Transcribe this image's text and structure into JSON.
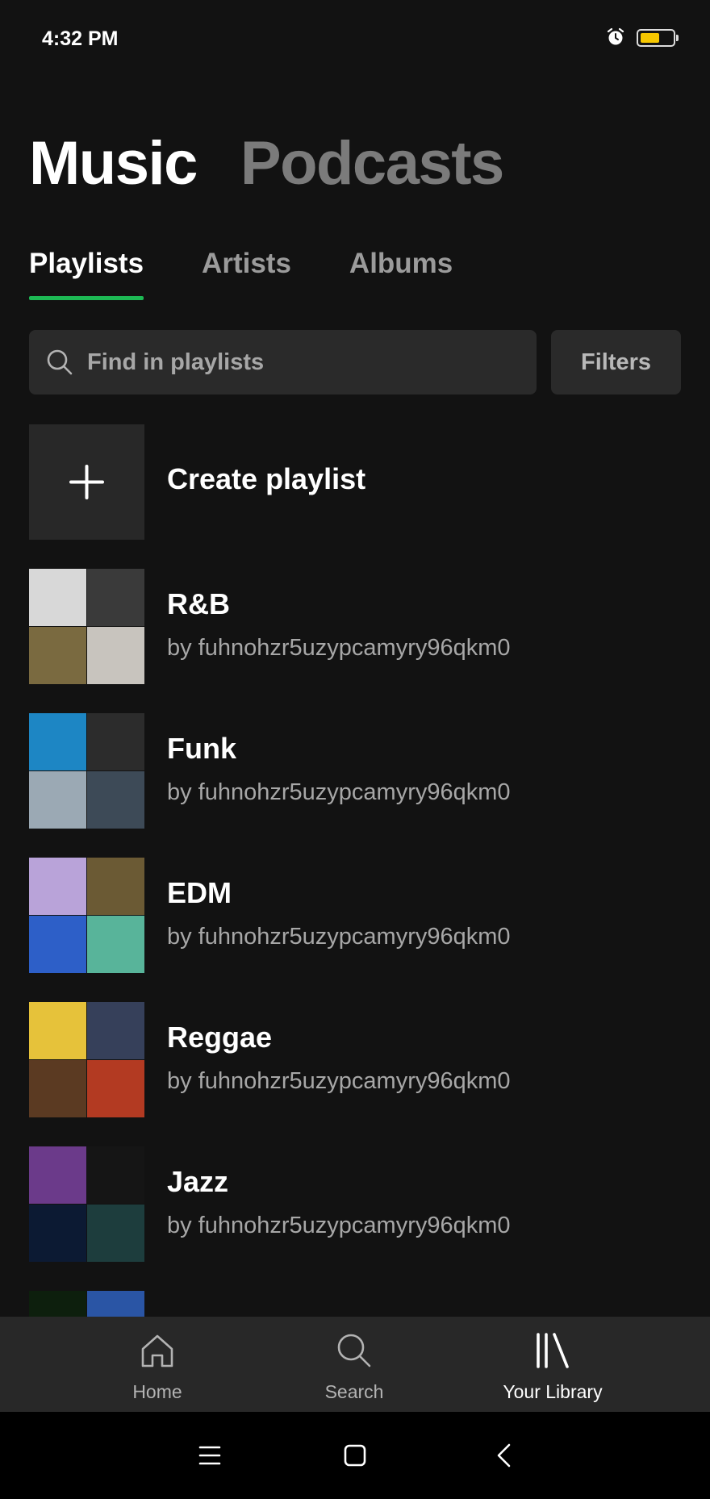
{
  "status_bar": {
    "time": "4:32 PM",
    "battery_level": 0.6,
    "icons": [
      "alarm-icon",
      "battery-icon"
    ]
  },
  "header": {
    "tabs": [
      "Music",
      "Podcasts"
    ],
    "active": "Music"
  },
  "sub_tabs": {
    "tabs": [
      "Playlists",
      "Artists",
      "Albums"
    ],
    "active": "Playlists"
  },
  "search": {
    "placeholder": "Find in playlists",
    "filters_label": "Filters"
  },
  "create_playlist": {
    "label": "Create playlist"
  },
  "playlists": [
    {
      "title": "R&B",
      "subtitle": "by fuhnohzr5uzypcamyry96qkm0",
      "cover_colors": [
        "#d8d8d8",
        "#3a3a3a",
        "#7a6a40",
        "#c8c4be"
      ]
    },
    {
      "title": "Funk",
      "subtitle": "by fuhnohzr5uzypcamyry96qkm0",
      "cover_colors": [
        "#1d86c4",
        "#2c2c2c",
        "#9ba9b4",
        "#3d4a57"
      ]
    },
    {
      "title": "EDM",
      "subtitle": "by fuhnohzr5uzypcamyry96qkm0",
      "cover_colors": [
        "#b9a3d9",
        "#6b5a34",
        "#2d5fc8",
        "#58b49a"
      ]
    },
    {
      "title": "Reggae",
      "subtitle": "by fuhnohzr5uzypcamyry96qkm0",
      "cover_colors": [
        "#e6c23a",
        "#36405a",
        "#5b3a22",
        "#b33a22"
      ]
    },
    {
      "title": "Jazz",
      "subtitle": "by fuhnohzr5uzypcamyry96qkm0",
      "cover_colors": [
        "#6b3a8a",
        "#151515",
        "#0c1a33",
        "#1d3d3d"
      ]
    },
    {
      "title": "",
      "subtitle": "",
      "cover_colors": [
        "#0d1f0d",
        "#2a55a5",
        "#101010",
        "#101010"
      ]
    }
  ],
  "bottom_nav": {
    "items": [
      {
        "label": "Home",
        "icon": "home-icon"
      },
      {
        "label": "Search",
        "icon": "search-icon"
      },
      {
        "label": "Your Library",
        "icon": "library-icon"
      }
    ],
    "active": "Your Library"
  },
  "system_nav": {
    "icons": [
      "menu-icon",
      "home-square-icon",
      "back-icon"
    ]
  },
  "colors": {
    "background": "#121212",
    "accent": "#1db954",
    "surface": "#2a2a2a",
    "nav_background": "#282828"
  }
}
